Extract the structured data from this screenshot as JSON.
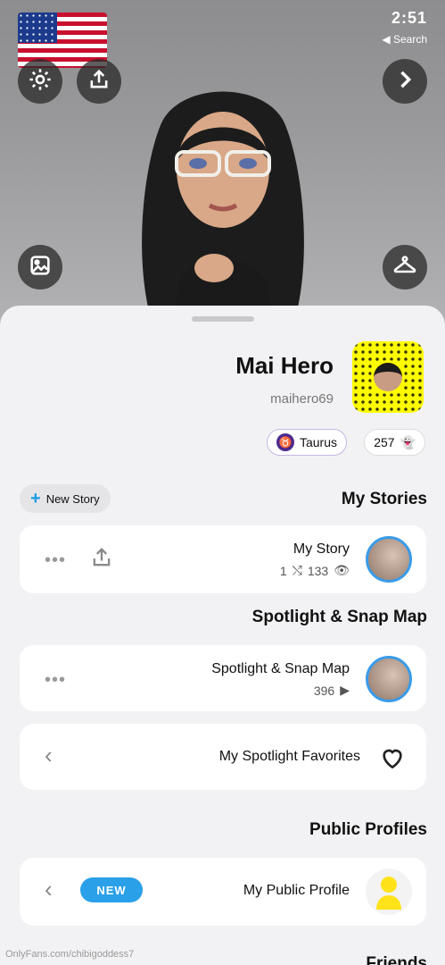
{
  "status_bar": {
    "time": "2:51",
    "back_label": "◀ Search"
  },
  "header": {
    "flag_icon": "us-flag",
    "settings_icon": "gear-icon",
    "share_icon": "share-upload-icon",
    "forward_icon": "chevron-right-icon",
    "photo_icon": "image-icon",
    "outfit_icon": "hanger-icon"
  },
  "profile": {
    "name": "Mai Hero",
    "username": "maihero69",
    "zodiac": "Taurus",
    "snap_score": "257"
  },
  "my_stories": {
    "section_title": "My Stories",
    "new_story_label": "New Story",
    "story": {
      "title": "My Story",
      "views": "133",
      "screenshots": "1"
    }
  },
  "spotlight": {
    "section_title": "Spotlight & Snap Map",
    "item": {
      "title": "Spotlight & Snap Map",
      "plays": "396"
    },
    "favorites_label": "My Spotlight Favorites"
  },
  "public_profiles": {
    "section_title": "Public Profiles",
    "item_label": "My Public Profile",
    "badge": "NEW"
  },
  "friends_title": "Friends",
  "watermark": "OnlyFans.com/chibigoddess7",
  "colors": {
    "accent_blue": "#2aa0e8",
    "snap_yellow": "#fffc00",
    "zodiac_purple": "#4b2a8f"
  }
}
